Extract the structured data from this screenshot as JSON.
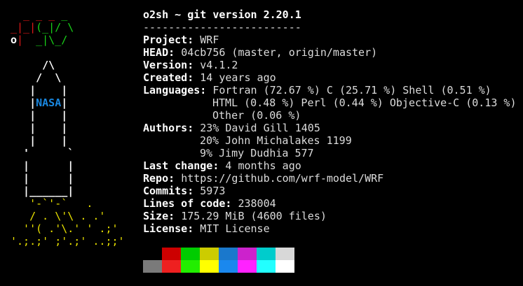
{
  "logo": {
    "lines": [
      [
        {
          "t": "  _ _ _",
          "c": "c-red"
        },
        {
          "t": " _",
          "c": "c-green"
        }
      ],
      [
        {
          "t": "_|_|",
          "c": "c-red"
        },
        {
          "t": "(_|/ \\",
          "c": "c-green"
        }
      ],
      [
        {
          "t": "o",
          "c": "c-white"
        },
        {
          "t": "|",
          "c": "c-red"
        },
        {
          "t": "  _|\\_/",
          "c": "c-green"
        }
      ],
      [
        {
          "t": "",
          "c": ""
        }
      ],
      [
        {
          "t": "     /\\",
          "c": "c-white"
        }
      ],
      [
        {
          "t": "    /  \\",
          "c": "c-white"
        }
      ],
      [
        {
          "t": "   |    |",
          "c": "c-white"
        }
      ],
      [
        {
          "t": "   |",
          "c": "c-white"
        },
        {
          "t": "NASA",
          "c": "c-blue"
        },
        {
          "t": "|",
          "c": "c-white"
        }
      ],
      [
        {
          "t": "   |    |",
          "c": "c-white"
        }
      ],
      [
        {
          "t": "   |    |",
          "c": "c-white"
        }
      ],
      [
        {
          "t": "   |    |",
          "c": "c-white"
        }
      ],
      [
        {
          "t": "  '      `",
          "c": "c-white"
        }
      ],
      [
        {
          "t": "  |      |",
          "c": "c-white"
        }
      ],
      [
        {
          "t": "  |      |",
          "c": "c-white"
        }
      ],
      [
        {
          "t": "  |______|",
          "c": "c-white"
        }
      ],
      [
        {
          "t": "   '-`'-`   .",
          "c": "c-yellow"
        }
      ],
      [
        {
          "t": "   / . \\'\\ . .'",
          "c": "c-yellow"
        }
      ],
      [
        {
          "t": "  ''( .'\\.' ' .;'",
          "c": "c-yellow"
        }
      ],
      [
        {
          "t": "'.;.;' ;'.;' ..;;'",
          "c": "c-yellow"
        }
      ]
    ]
  },
  "header": {
    "title": "o2sh ~ git version 2.20.1",
    "separator": "-------------------------"
  },
  "info": {
    "project_key": "Project: ",
    "project_val": "WRF",
    "head_key": "HEAD: ",
    "head_val": "04cb756 (master, origin/master)",
    "version_key": "Version: ",
    "version_val": "v4.1.2",
    "created_key": "Created: ",
    "created_val": "14 years ago",
    "languages_key": "Languages: ",
    "languages_line1": "Fortran (72.67 %) C (25.71 %) Shell (0.51 %)",
    "languages_line2": "HTML (0.48 %) Perl (0.44 %) Objective-C (0.13 %)",
    "languages_line3": "Other (0.06 %)",
    "authors_key": "Authors: ",
    "authors_line1": "23% David Gill 1405",
    "authors_line2": "20% John Michalakes 1199",
    "authors_line3": "9% Jimy Dudhia 577",
    "lastchange_key": "Last change: ",
    "lastchange_val": "4 months ago",
    "repo_key": "Repo: ",
    "repo_val": "https://github.com/wrf-model/WRF",
    "commits_key": "Commits: ",
    "commits_val": "5973",
    "loc_key": "Lines of code: ",
    "loc_val": "238004",
    "size_key": "Size: ",
    "size_val": "175.29 MiB (4600 files)",
    "license_key": "License: ",
    "license_val": "MIT License"
  },
  "palette": {
    "row1": [
      "#000000",
      "#cc0000",
      "#00cc00",
      "#cccc00",
      "#1a78cc",
      "#cc22cc",
      "#00cccc",
      "#d8d8d8"
    ],
    "row2": [
      "#7a7a7a",
      "#ee2020",
      "#22ee00",
      "#ffff00",
      "#1a88ee",
      "#ff22ff",
      "#22ffff",
      "#ffffff"
    ]
  }
}
